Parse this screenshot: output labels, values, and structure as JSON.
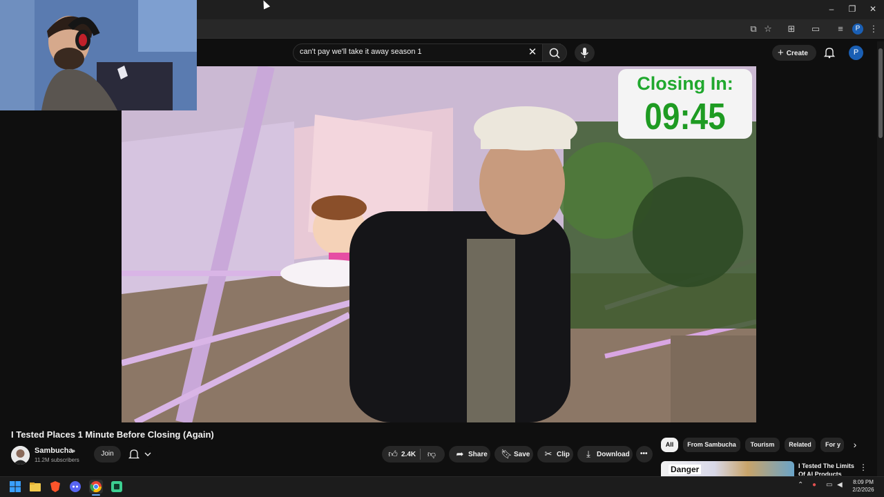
{
  "browser": {
    "window_controls": [
      "minimize",
      "restore",
      "close"
    ],
    "toolbar_icons": [
      "install-app-icon",
      "bookmark-star-icon",
      "extensions-icon",
      "split-view-icon",
      "media-control-icon",
      "profile-icon",
      "kebab-menu-icon"
    ],
    "profile_initial": "P"
  },
  "youtube": {
    "search": {
      "query": "can't pay we'll take it away season 1",
      "clear_glyph": "✕"
    },
    "header": {
      "create_label": "Create",
      "avatar_initial": "P"
    },
    "overlay": {
      "label": "Closing In:",
      "countdown": "09:45"
    },
    "video": {
      "title": "I Tested Places 1 Minute Before Closing (Again)",
      "channel": "Sambucha",
      "subscribers": "11.2M subscribers",
      "join_label": "Join",
      "like_count": "2.4K",
      "share_label": "Share",
      "save_label": "Save",
      "clip_label": "Clip",
      "download_label": "Download"
    },
    "chips": [
      "All",
      "From Sambucha",
      "Tourism",
      "Related",
      "For y"
    ],
    "recommendation": {
      "title": "I Tested The Limits Of AI Products",
      "thumb_text": "Danger"
    }
  },
  "taskbar": {
    "apps": [
      "windows-start",
      "file-explorer",
      "brave",
      "discord",
      "chrome",
      "terminal"
    ],
    "time": "8:09 PM",
    "date": "2/2/2026"
  },
  "colors": {
    "timer_green": "#1e9b22",
    "youtube_bg": "#0f0f0f",
    "chip_active": "#f1f1f1"
  }
}
